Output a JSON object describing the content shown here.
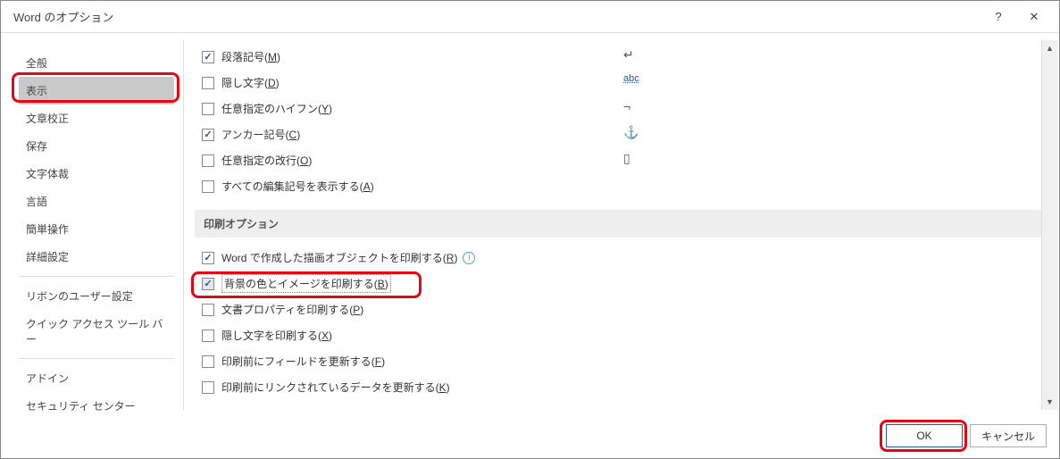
{
  "title": "Word のオプション",
  "help_symbol": "?",
  "close_symbol": "✕",
  "sidebar": {
    "items": [
      {
        "label": "全般"
      },
      {
        "label": "表示"
      },
      {
        "label": "文章校正"
      },
      {
        "label": "保存"
      },
      {
        "label": "文字体裁"
      },
      {
        "label": "言語"
      },
      {
        "label": "簡単操作"
      },
      {
        "label": "詳細設定"
      }
    ],
    "items2": [
      {
        "label": "リボンのユーザー設定"
      },
      {
        "label": "クイック アクセス ツール バー"
      }
    ],
    "items3": [
      {
        "label": "アドイン"
      },
      {
        "label": "セキュリティ センター"
      }
    ]
  },
  "formatting_marks": {
    "paragraph_label_a": "段落記号(",
    "paragraph_key": "M",
    "paragraph_label_b": ")",
    "paragraph_icon": "↵",
    "hidden_label_a": "隠し文字(",
    "hidden_key": "D",
    "hidden_label_b": ")",
    "hidden_icon": "abc",
    "hyphen_label_a": "任意指定のハイフン(",
    "hyphen_key": "Y",
    "hyphen_label_b": ")",
    "hyphen_icon": "¬",
    "anchor_label_a": "アンカー記号(",
    "anchor_key": "C",
    "anchor_label_b": ")",
    "anchor_icon": "⚓",
    "break_label_a": "任意指定の改行(",
    "break_key": "O",
    "break_label_b": ")",
    "break_icon": "▯",
    "all_label_a": "すべての編集記号を表示する(",
    "all_key": "A",
    "all_label_b": ")"
  },
  "print_section_title": "印刷オプション",
  "print_opts": {
    "drawings_a": "Word で作成した描画オブジェクトを印刷する(",
    "drawings_key": "R",
    "drawings_b": ")",
    "bg_a": "背景の色とイメージを印刷する(",
    "bg_key": "B",
    "bg_b": ")",
    "props_a": "文書プロパティを印刷する(",
    "props_key": "P",
    "props_b": ")",
    "hidden_a": "隠し文字を印刷する(",
    "hidden_key": "X",
    "hidden_b": ")",
    "fields_a": "印刷前にフィールドを更新する(",
    "fields_key": "F",
    "fields_b": ")",
    "links_a": "印刷前にリンクされているデータを更新する(",
    "links_key": "K",
    "links_b": ")"
  },
  "buttons": {
    "ok": "OK",
    "cancel": "キャンセル"
  }
}
